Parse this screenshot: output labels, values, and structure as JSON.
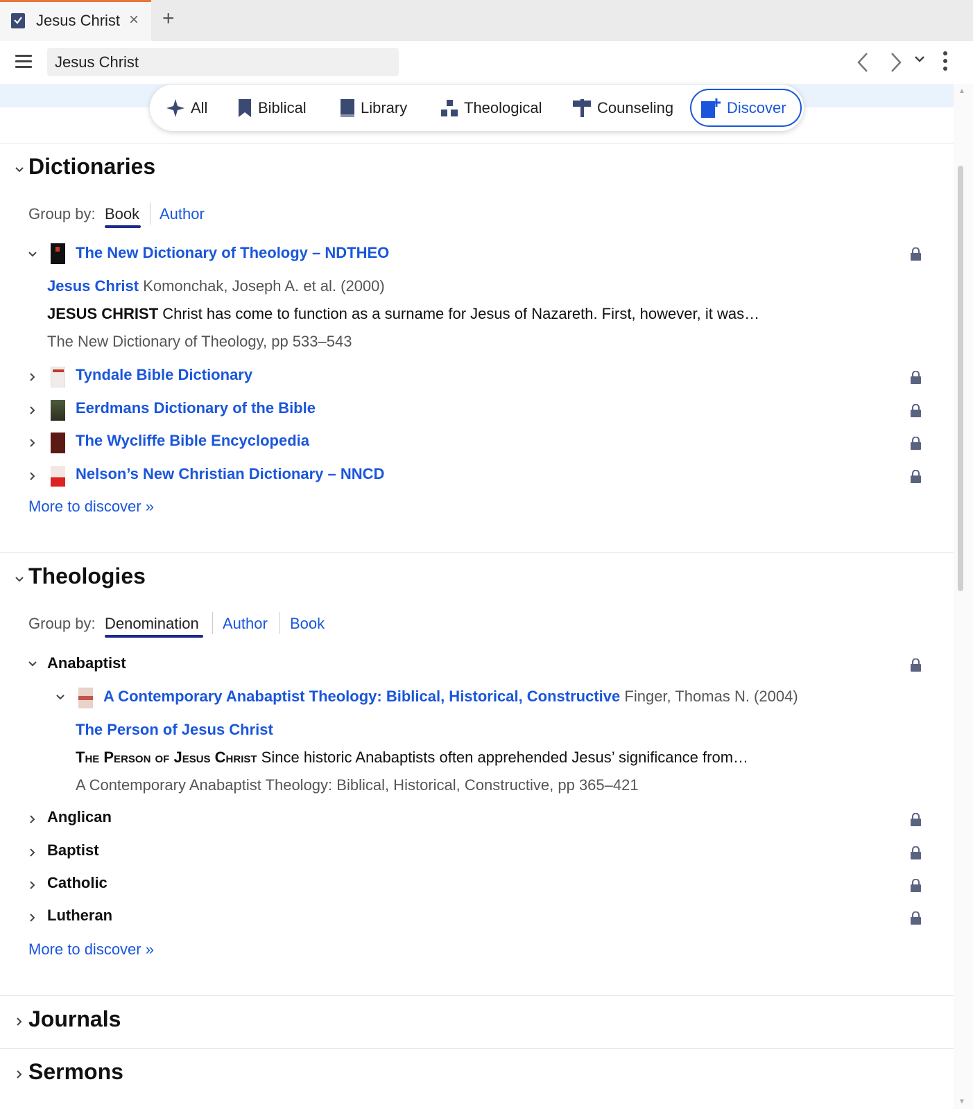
{
  "tab": {
    "title": "Jesus Christ",
    "close": "×",
    "add": "+"
  },
  "toolbar": {
    "search_value": "Jesus Christ",
    "back": "‹",
    "forward": "›"
  },
  "filters": [
    {
      "label": "All",
      "icon": "sparkle-icon"
    },
    {
      "label": "Biblical",
      "icon": "bookmark-icon"
    },
    {
      "label": "Library",
      "icon": "book-icon"
    },
    {
      "label": "Theological",
      "icon": "hierarchy-icon"
    },
    {
      "label": "Counseling",
      "icon": "signpost-icon"
    },
    {
      "label": "Discover",
      "icon": "add-book-icon",
      "active": true
    }
  ],
  "dictionaries": {
    "title": "Dictionaries",
    "group_by_label": "Group by:",
    "group_by_options": [
      "Book",
      "Author"
    ],
    "expanded": {
      "book_title": "The New Dictionary of Theology – NDTHEO",
      "article_title": "Jesus Christ",
      "article_meta": "Komonchak, Joseph A. et al. (2000)",
      "snippet_head": "JESUS CHRIST",
      "snippet": "Christ has come to function as a surname for Jesus of Nazareth. First, however, it was…",
      "source": "The New Dictionary of Theology, pp 533–543"
    },
    "books": [
      "Tyndale Bible Dictionary",
      "Eerdmans Dictionary of the Bible",
      "The Wycliffe Bible Encyclopedia",
      "Nelson’s New Christian Dictionary – NNCD"
    ],
    "more": "More to discover »"
  },
  "theologies": {
    "title": "Theologies",
    "group_by_label": "Group by:",
    "group_by_options": [
      "Denomination",
      "Author",
      "Book"
    ],
    "expanded_group": "Anabaptist",
    "expanded_book": {
      "title": "A Contemporary Anabaptist Theology: Biblical, Historical, Constructive",
      "meta": "Finger, Thomas N. (2004)",
      "article_title": "The Person of Jesus Christ",
      "snippet_head": "The Person of Jesus Christ",
      "snippet": "Since historic Anabaptists often apprehended Jesus’ significance from…",
      "source": "A Contemporary Anabaptist Theology: Biblical, Historical, Constructive, pp 365–421"
    },
    "groups": [
      "Anglican",
      "Baptist",
      "Catholic",
      "Lutheran"
    ],
    "more": "More to discover »"
  },
  "journals": {
    "title": "Journals"
  },
  "sermons": {
    "title": "Sermons"
  },
  "colors": {
    "link": "#1a56db",
    "accent_tab": "#e8763a",
    "band": "#eaf3fd"
  }
}
